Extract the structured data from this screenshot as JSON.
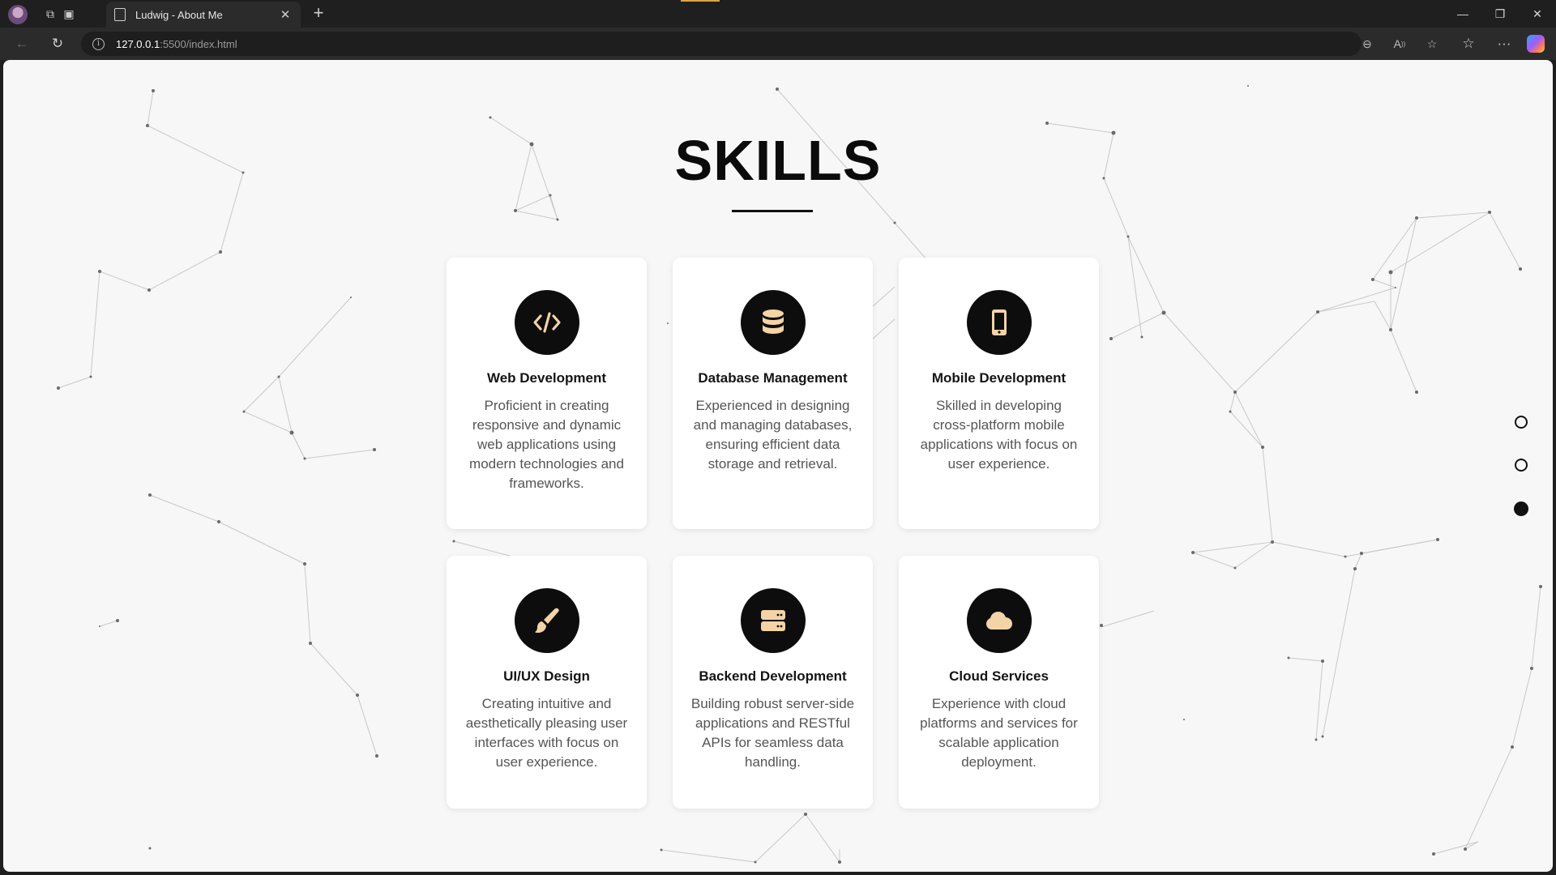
{
  "browser": {
    "tab_title": "Ludwig - About Me",
    "tab_close": "✕",
    "new_tab": "+",
    "url_host": "127.0.0.1",
    "url_path": ":5500/index.html"
  },
  "page": {
    "heading": "SKILLS",
    "cards": [
      {
        "title": "Web Development",
        "description": "Proficient in creating responsive and dynamic web applications using modern technologies and frameworks.",
        "icon": "code-icon"
      },
      {
        "title": "Database Management",
        "description": "Experienced in designing and managing databases, ensuring efficient data storage and retrieval.",
        "icon": "database-icon"
      },
      {
        "title": "Mobile Development",
        "description": "Skilled in developing cross-platform mobile applications with focus on user experience.",
        "icon": "mobile-icon"
      },
      {
        "title": "UI/UX Design",
        "description": "Creating intuitive and aesthetically pleasing user interfaces with focus on user experience.",
        "icon": "paintbrush-icon"
      },
      {
        "title": "Backend Development",
        "description": "Building robust server-side applications and RESTful APIs for seamless data handling.",
        "icon": "server-icon"
      },
      {
        "title": "Cloud Services",
        "description": "Experience with cloud platforms and services for scalable application deployment.",
        "icon": "cloud-icon"
      }
    ],
    "section_nav": {
      "count": 3,
      "active_index": 2
    }
  },
  "colors": {
    "page_bg": "#f7f7f8",
    "icon_bg": "#0d0d0d",
    "icon_fg": "#f4d3a6",
    "heading": "#0b0b0b",
    "text_muted": "#555555"
  }
}
